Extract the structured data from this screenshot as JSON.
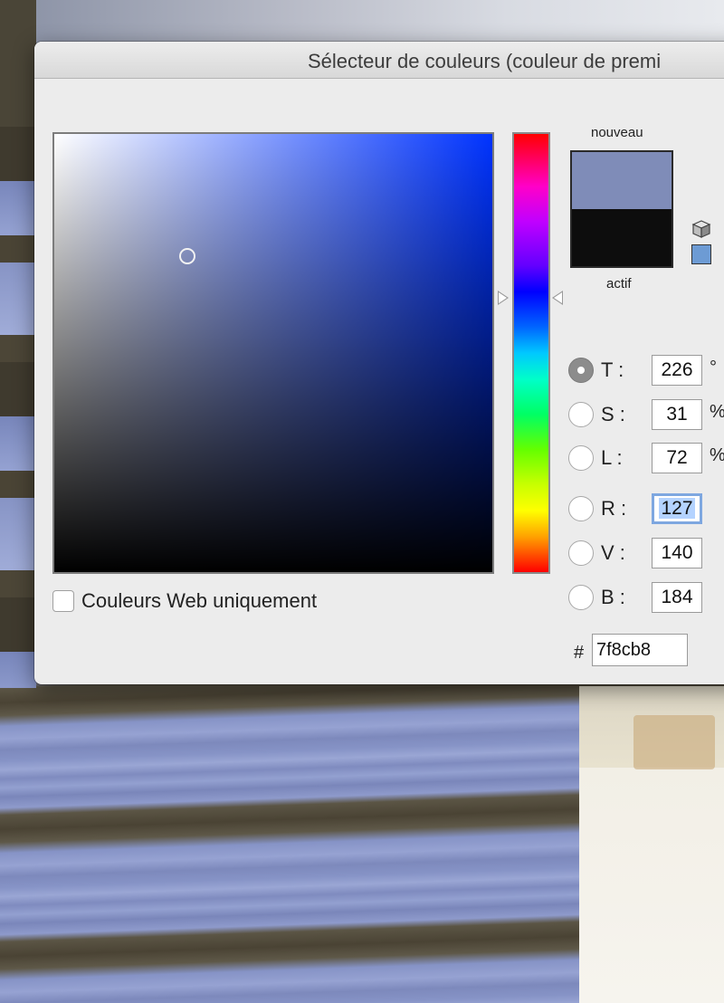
{
  "window": {
    "title": "Sélecteur de couleurs (couleur de premi"
  },
  "swatch": {
    "new_label": "nouveau",
    "current_label": "actif",
    "new_color": "#7f8cb8",
    "current_color": "#0d0d0d"
  },
  "channels": [
    {
      "label": "T :",
      "value": "226",
      "unit": "°",
      "checked": true
    },
    {
      "label": "S :",
      "value": "31",
      "unit": "%",
      "checked": false
    },
    {
      "label": "L :",
      "value": "72",
      "unit": "%",
      "checked": false
    },
    {
      "label": "R :",
      "value": "127",
      "unit": "",
      "checked": false
    },
    {
      "label": "V :",
      "value": "140",
      "unit": "",
      "checked": false
    },
    {
      "label": "B :",
      "value": "184",
      "unit": "",
      "checked": false
    }
  ],
  "hex": {
    "prefix": "#",
    "value": "7f8cb8"
  },
  "web_only": {
    "label": "Couleurs Web uniquement",
    "checked": false
  },
  "icons": {
    "cube": "cube-icon",
    "web_swatch": "web-color-swatch-icon",
    "web_swatch_color": "#6d9bd4"
  }
}
